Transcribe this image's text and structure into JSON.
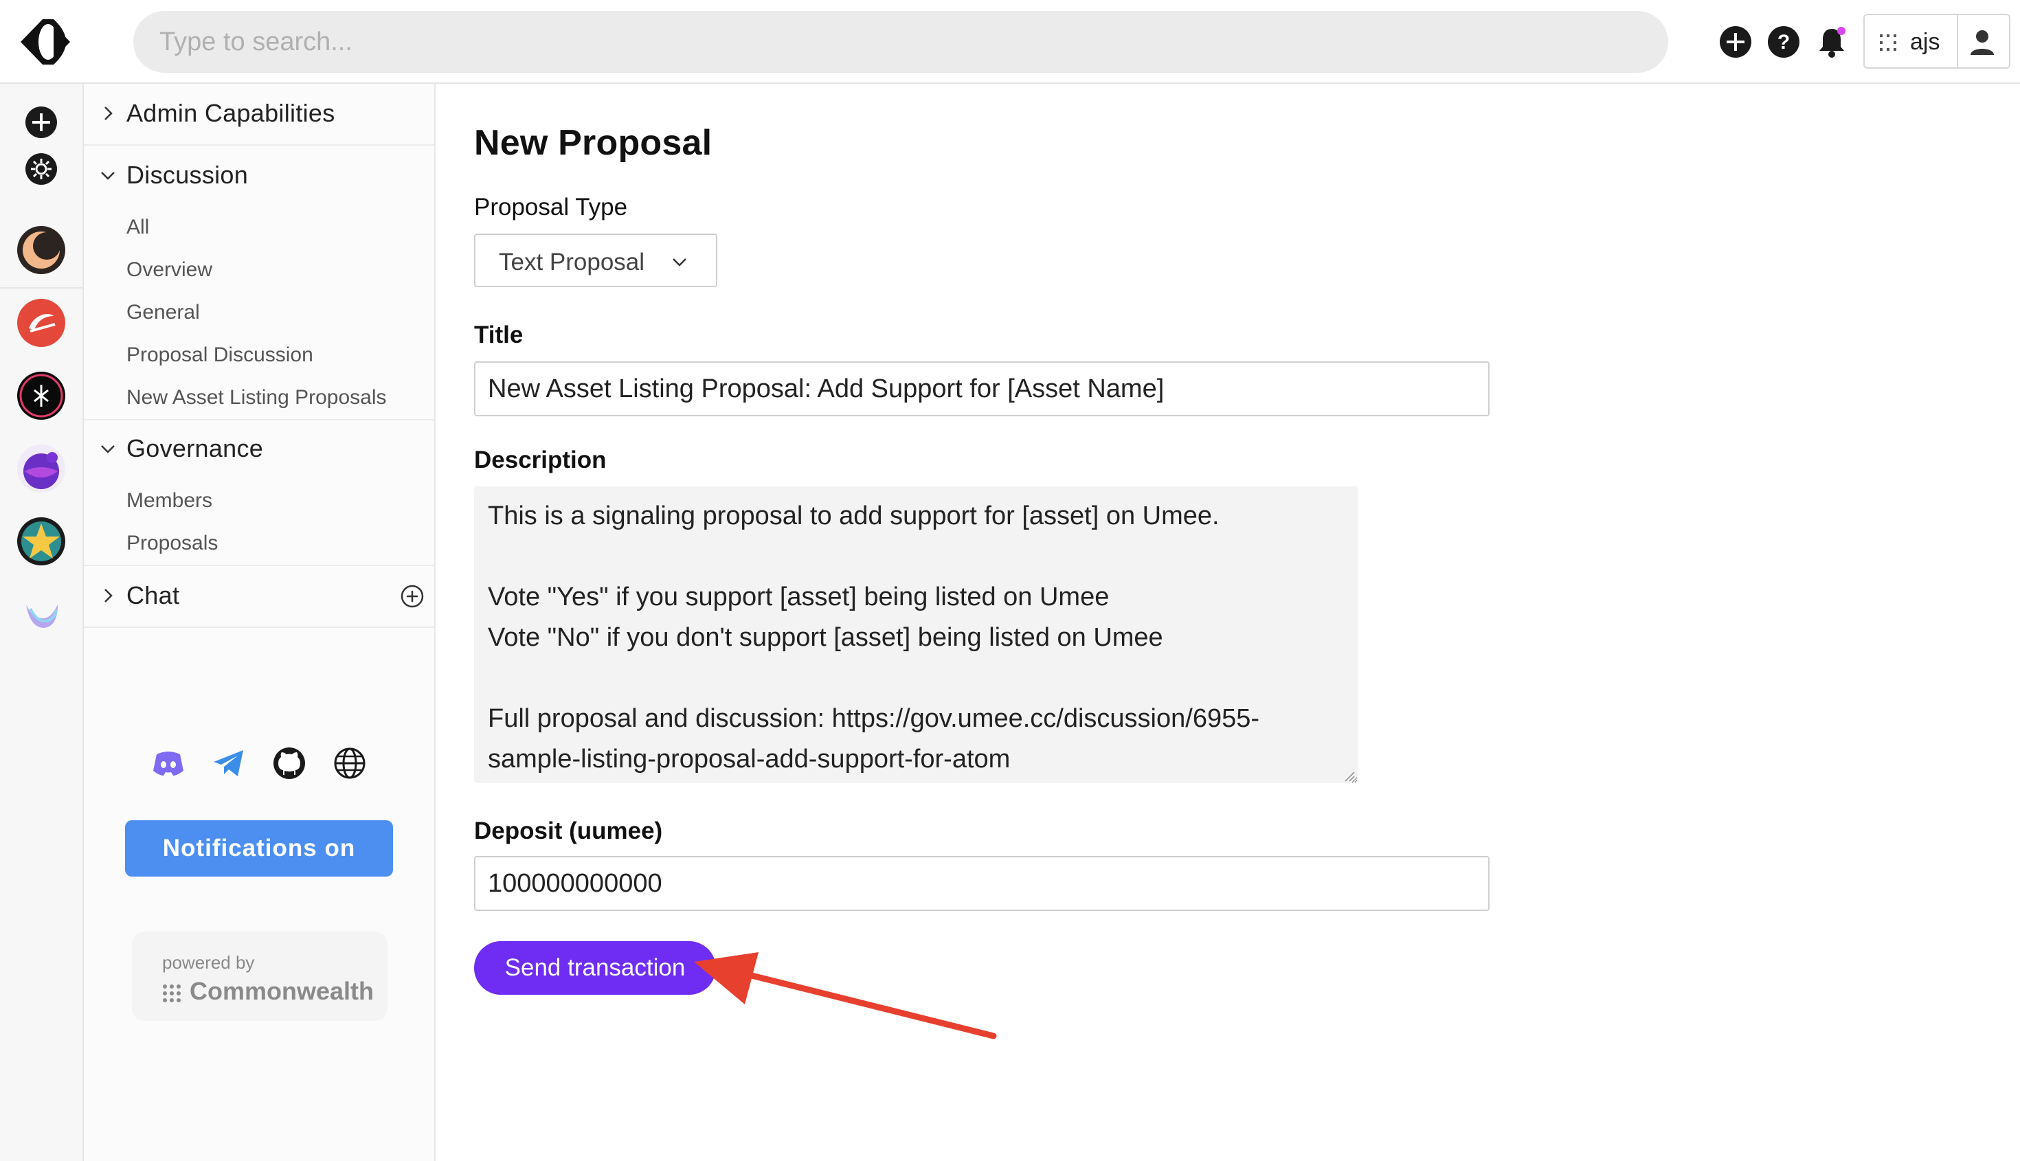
{
  "header": {
    "search_placeholder": "Type to search...",
    "account_name": "ajs",
    "icons": [
      "create-icon",
      "help-icon",
      "notifications-bell-icon",
      "user-icon"
    ]
  },
  "rail": {
    "icons": [
      "add-community-icon",
      "explore-icon",
      "community-1",
      "community-2",
      "community-3",
      "community-4",
      "community-5",
      "community-umee"
    ]
  },
  "sidebar": {
    "admin_label": "Admin Capabilities",
    "discussion_label": "Discussion",
    "discussion_items": [
      "All",
      "Overview",
      "General",
      "Proposal Discussion",
      "New Asset Listing Proposals"
    ],
    "governance_label": "Governance",
    "governance_items": [
      "Members",
      "Proposals"
    ],
    "chat_label": "Chat",
    "social_icons": [
      "discord-icon",
      "telegram-icon",
      "github-icon",
      "website-globe-icon"
    ],
    "notifications_button": "Notifications on",
    "powered_by": "powered by",
    "brand": "Commonwealth"
  },
  "form": {
    "page_title": "New Proposal",
    "proposal_type_label": "Proposal Type",
    "proposal_type_value": "Text Proposal",
    "title_label": "Title",
    "title_value": "New Asset Listing Proposal: Add Support for [Asset Name]",
    "description_label": "Description",
    "description_value": "This is a signaling proposal to add support for [asset] on Umee.\n\nVote \"Yes\" if you support [asset] being listed on Umee\nVote \"No\" if you don't support [asset] being listed on Umee\n\nFull proposal and discussion: https://gov.umee.cc/discussion/6955-sample-listing-proposal-add-support-for-atom",
    "deposit_label": "Deposit (uumee)",
    "deposit_value": "100000000000",
    "send_button": "Send transaction"
  },
  "colors": {
    "accent_purple": "#6f2cf2",
    "notifications_blue": "#4d8ff0",
    "annotation_arrow": "#e8402e"
  }
}
